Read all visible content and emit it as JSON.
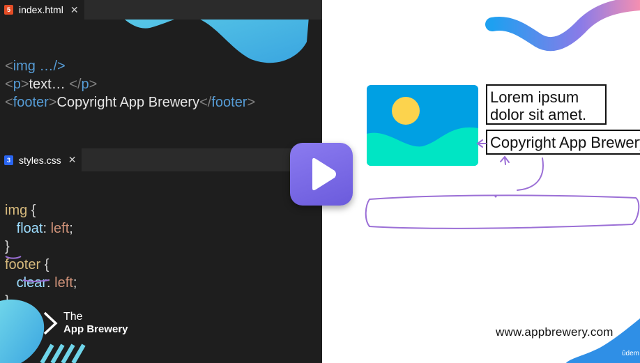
{
  "html_tab": {
    "icon": "html5-icon",
    "icon_glyph": "5",
    "filename": "index.html",
    "close": "✕"
  },
  "css_tab": {
    "icon": "css3-icon",
    "icon_glyph": "3",
    "filename": "styles.css",
    "close": "✕"
  },
  "html_code": {
    "l1_open": "<",
    "l1_tag": "img",
    "l1_rest": " …/>",
    "l2_open": "<",
    "l2_tag": "p",
    "l2_close": ">",
    "l2_text": "text… ",
    "l2_end_open": "</",
    "l2_end_tag": "p",
    "l2_end_close": ">",
    "l3_open": "<",
    "l3_tag": "footer",
    "l3_close": ">",
    "l3_text": "Copyright App Brewery",
    "l3_end_open": "</",
    "l3_end_tag": "footer",
    "l3_end_close": ">"
  },
  "css_code": {
    "r1_sel": "img",
    "r1_brace": " {",
    "r1_prop": "float",
    "r1_colon": ": ",
    "r1_val": "left",
    "r1_semi": ";",
    "r1_end": "}",
    "r2_sel": "footer",
    "r2_brace": " {",
    "r2_prop": "clear",
    "r2_colon": ": ",
    "r2_val": "left",
    "r2_semi": ";",
    "r2_end": "}"
  },
  "brand": {
    "line1": "The",
    "line2": "App Brewery"
  },
  "preview": {
    "paragraph_line1": "Lorem ipsum",
    "paragraph_line2": "dolor sit amet.",
    "footer_text": "Copyright App Brewery"
  },
  "website": "www.appbrewery.com",
  "watermark": "ûdem",
  "colors": {
    "editor_bg": "#1e1e1e",
    "tag_name": "#569cd6",
    "selector": "#d7ba7d",
    "property": "#9cdcfe",
    "value": "#ce9178",
    "play_button": "#7b6be8",
    "annotation": "#9b6fd6",
    "image_sky": "#00a0e3",
    "image_hill": "#00e5c4",
    "image_sun": "#fcd34d"
  }
}
